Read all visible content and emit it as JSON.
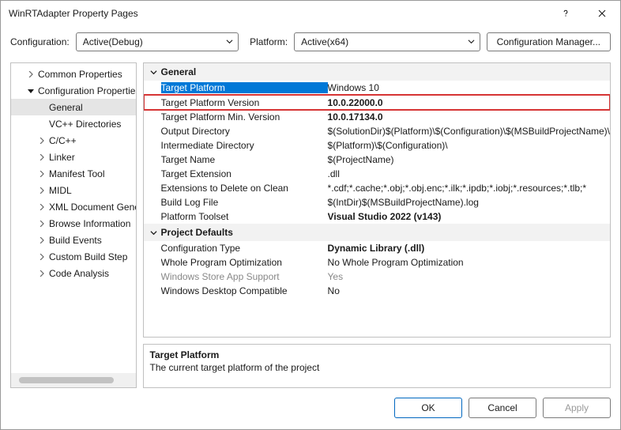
{
  "window": {
    "title": "WinRTAdapter Property Pages"
  },
  "topbar": {
    "config_label": "Configuration:",
    "config_value": "Active(Debug)",
    "platform_label": "Platform:",
    "platform_value": "Active(x64)",
    "cfg_mgr": "Configuration Manager..."
  },
  "tree": {
    "common": "Common Properties",
    "config_props": "Configuration Properties",
    "items": [
      "General",
      "VC++ Directories",
      "C/C++",
      "Linker",
      "Manifest Tool",
      "MIDL",
      "XML Document Generator",
      "Browse Information",
      "Build Events",
      "Custom Build Step",
      "Code Analysis"
    ]
  },
  "sections": {
    "general": {
      "title": "General",
      "rows": [
        {
          "k": "Target Platform",
          "v": "Windows 10"
        },
        {
          "k": "Target Platform Version",
          "v": "10.0.22000.0"
        },
        {
          "k": "Target Platform Min. Version",
          "v": "10.0.17134.0"
        },
        {
          "k": "Output Directory",
          "v": "$(SolutionDir)$(Platform)\\$(Configuration)\\$(MSBuildProjectName)\\"
        },
        {
          "k": "Intermediate Directory",
          "v": "$(Platform)\\$(Configuration)\\"
        },
        {
          "k": "Target Name",
          "v": "$(ProjectName)"
        },
        {
          "k": "Target Extension",
          "v": ".dll"
        },
        {
          "k": "Extensions to Delete on Clean",
          "v": "*.cdf;*.cache;*.obj;*.obj.enc;*.ilk;*.ipdb;*.iobj;*.resources;*.tlb;*"
        },
        {
          "k": "Build Log File",
          "v": "$(IntDir)$(MSBuildProjectName).log"
        },
        {
          "k": "Platform Toolset",
          "v": "Visual Studio 2022 (v143)"
        }
      ]
    },
    "defaults": {
      "title": "Project Defaults",
      "rows": [
        {
          "k": "Configuration Type",
          "v": "Dynamic Library (.dll)"
        },
        {
          "k": "Whole Program Optimization",
          "v": "No Whole Program Optimization"
        },
        {
          "k": "Windows Store App Support",
          "v": "Yes"
        },
        {
          "k": "Windows Desktop Compatible",
          "v": "No"
        }
      ]
    }
  },
  "description": {
    "title": "Target Platform",
    "text": "The current target platform of the project"
  },
  "footer": {
    "ok": "OK",
    "cancel": "Cancel",
    "apply": "Apply"
  }
}
